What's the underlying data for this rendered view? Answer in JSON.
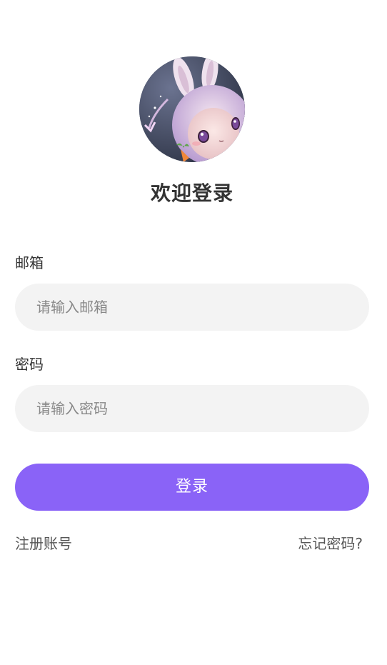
{
  "header": {
    "title": "欢迎登录"
  },
  "form": {
    "email": {
      "label": "邮箱",
      "placeholder": "请输入邮箱",
      "value": ""
    },
    "password": {
      "label": "密码",
      "placeholder": "请输入密码",
      "value": ""
    }
  },
  "actions": {
    "login_label": "登录",
    "register_label": "注册账号",
    "forgot_label": "忘记密码?"
  },
  "colors": {
    "primary": "#8a63f7",
    "input_bg": "#f3f3f3",
    "text": "#333333"
  }
}
